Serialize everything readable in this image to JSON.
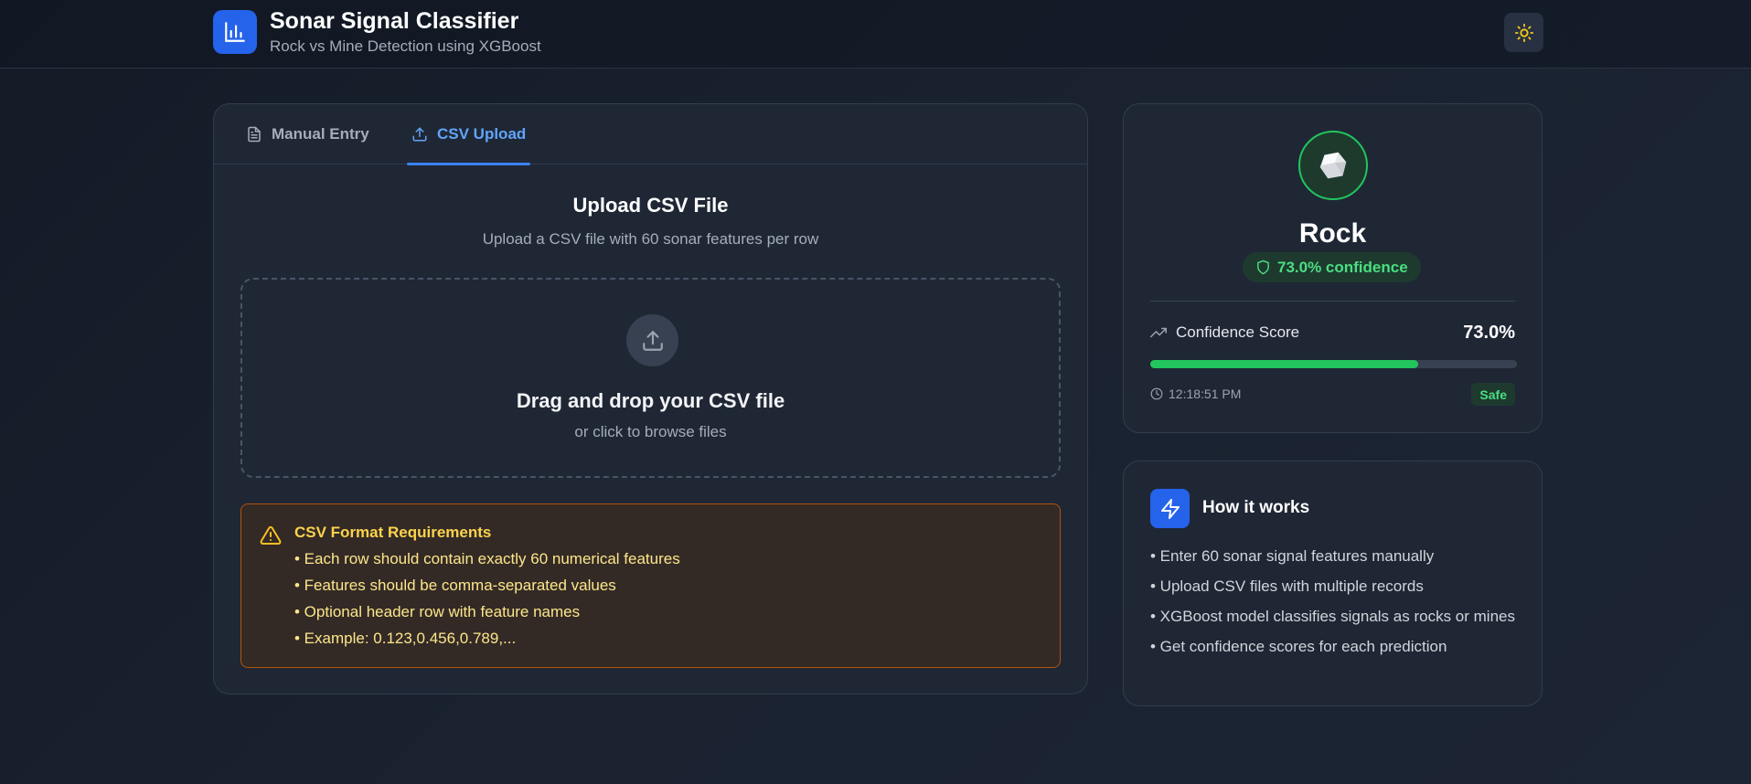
{
  "header": {
    "title": "Sonar Signal Classifier",
    "subtitle": "Rock vs Mine Detection using XGBoost",
    "logo_icon": "bar-chart-icon",
    "theme_icon": "sun-icon"
  },
  "tabs": [
    {
      "label": "Manual Entry",
      "icon": "document-icon",
      "active": false
    },
    {
      "label": "CSV Upload",
      "icon": "upload-icon",
      "active": true
    }
  ],
  "upload": {
    "title": "Upload CSV File",
    "description": "Upload a CSV file with 60 sonar features per row",
    "drop_title": "Drag and drop your CSV file",
    "drop_subtitle": "or click to browse files"
  },
  "requirements": {
    "title": "CSV Format Requirements",
    "items": [
      "• Each row should contain exactly 60 numerical features",
      "• Features should be comma-separated values",
      "• Optional header row with feature names",
      "• Example: 0.123,0.456,0.789,..."
    ]
  },
  "result": {
    "label": "Rock",
    "confidence_text": "73.0% confidence",
    "score_label": "Confidence Score",
    "score_value": "73.0%",
    "score_fraction": 0.73,
    "timestamp": "12:18:51 PM",
    "status_badge": "Safe"
  },
  "how_it_works": {
    "title": "How it works",
    "items": [
      "• Enter 60 sonar signal features manually",
      "• Upload CSV files with multiple records",
      "• XGBoost model classifies signals as rocks or mines",
      "• Get confidence scores for each prediction"
    ]
  },
  "colors": {
    "accent": "#2563eb",
    "success": "#22c55e",
    "warning": "#f59e0b"
  }
}
